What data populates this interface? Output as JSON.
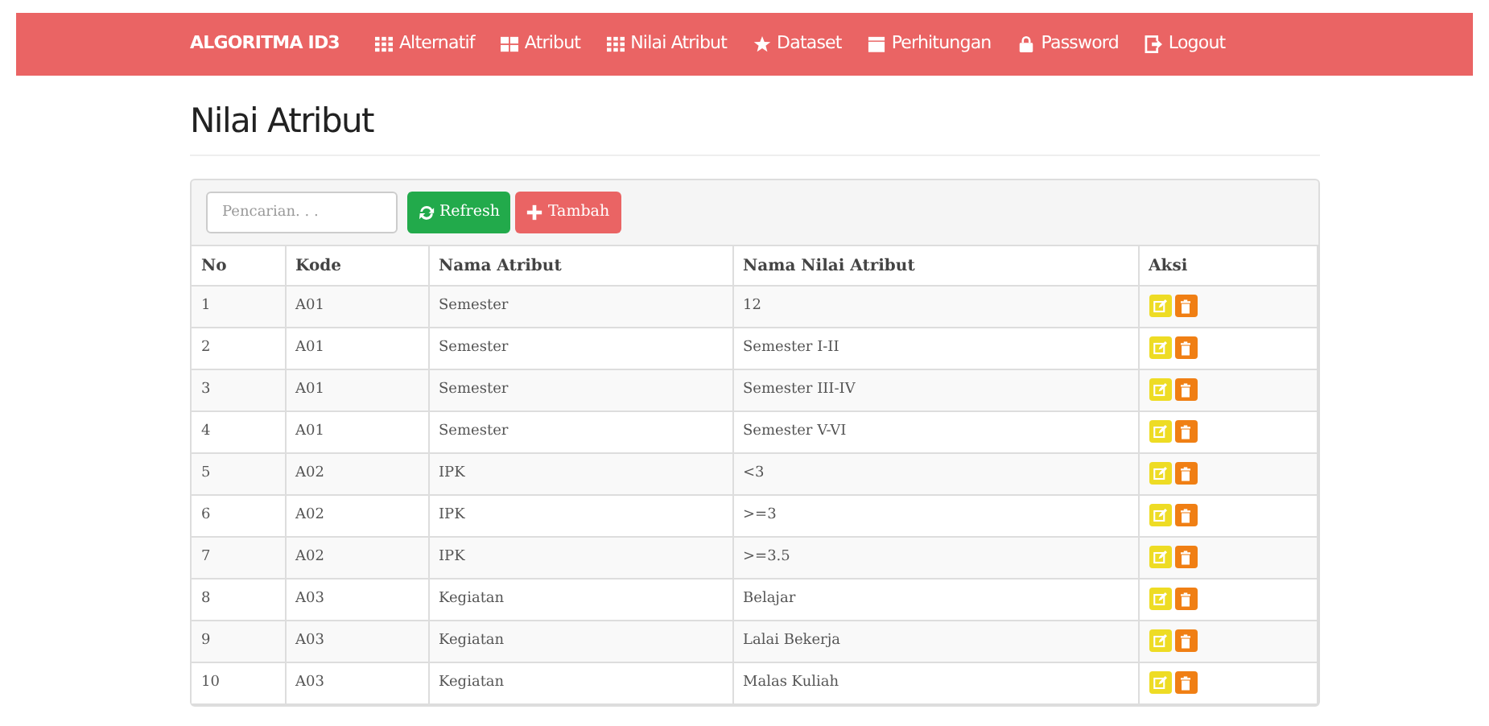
{
  "navbar": {
    "brand": "ALGORITMA ID3",
    "items": [
      {
        "label": "Alternatif"
      },
      {
        "label": "Atribut"
      },
      {
        "label": "Nilai Atribut"
      },
      {
        "label": "Dataset"
      },
      {
        "label": "Perhitungan"
      },
      {
        "label": "Password"
      },
      {
        "label": "Logout"
      }
    ]
  },
  "page_title": "Nilai Atribut",
  "search": {
    "placeholder": "Pencarian. . ."
  },
  "buttons": [
    {
      "label": "Refresh",
      "kind": "refresh"
    },
    {
      "label": "Tambah",
      "kind": "add"
    }
  ],
  "table": {
    "columns": [
      "No",
      "Kode",
      "Nama Atribut",
      "Nama Nilai Atribut",
      "Aksi"
    ],
    "rows": [
      [
        "1",
        "A01",
        "Semester",
        "12"
      ],
      [
        "2",
        "A01",
        "Semester",
        "Semester I-II"
      ],
      [
        "3",
        "A01",
        "Semester",
        "Semester III-IV"
      ],
      [
        "4",
        "A01",
        "Semester",
        "Semester V-VI"
      ],
      [
        "5",
        "A02",
        "IPK",
        "<3"
      ],
      [
        "6",
        "A02",
        "IPK",
        ">=3"
      ],
      [
        "7",
        "A02",
        "IPK",
        ">=3.5"
      ],
      [
        "8",
        "A03",
        "Kegiatan",
        "Belajar"
      ],
      [
        "9",
        "A03",
        "Kegiatan",
        "Lalai Bekerja"
      ],
      [
        "10",
        "A03",
        "Kegiatan",
        "Malas Kuliah"
      ]
    ]
  }
}
